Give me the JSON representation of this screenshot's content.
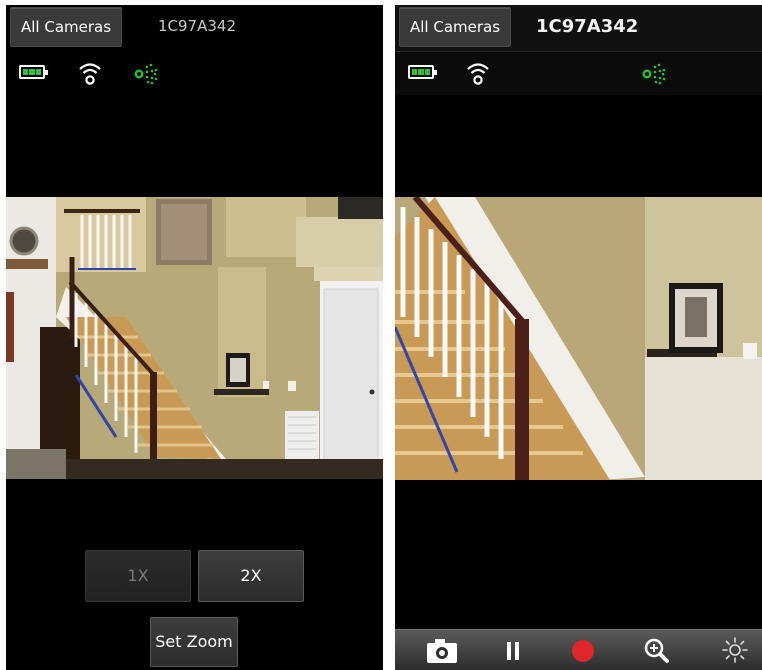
{
  "left_screen": {
    "nav_button": "All Cameras",
    "camera_id": "1C97A342",
    "status_icons": [
      "battery-icon",
      "wifi-icon",
      "motion-sensor-icon"
    ],
    "zoom_options": [
      "1X",
      "2X"
    ],
    "zoom_selected": "2X",
    "set_zoom_label": "Set Zoom"
  },
  "right_screen": {
    "nav_button": "All Cameras",
    "camera_id": "1C97A342",
    "status_icons": [
      "battery-icon",
      "wifi-icon",
      "motion-sensor-icon"
    ],
    "toolbar_icons": [
      "camera-snapshot-icon",
      "pause-icon",
      "record-icon",
      "zoom-in-icon",
      "brightness-icon"
    ]
  },
  "colors": {
    "background": "#000000",
    "battery_fill": "#2ec23b",
    "motion_icon": "#1ec33a",
    "record": "#e0262b",
    "wall": "#b9a777"
  }
}
